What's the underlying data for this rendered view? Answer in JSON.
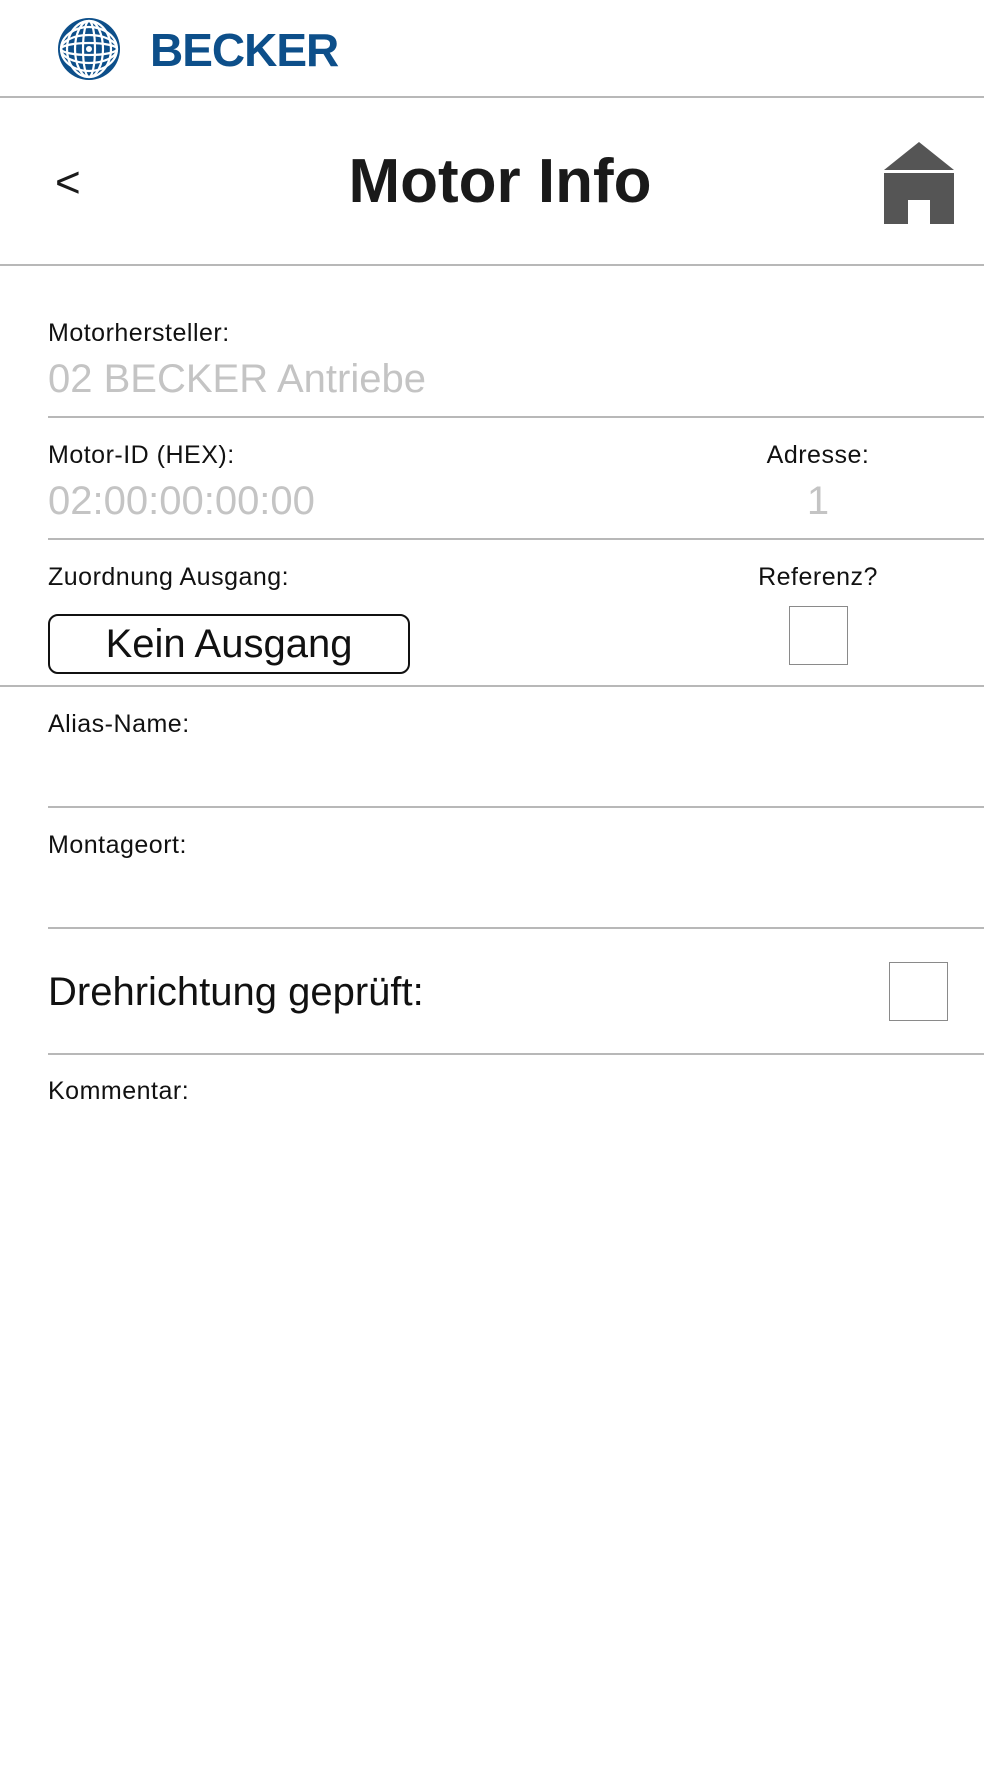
{
  "header": {
    "brand": "BECKER",
    "brand_color": "#0d4f8a",
    "logo_icon": "becker-logo-icon"
  },
  "titlebar": {
    "back_label": "<",
    "title": "Motor Info",
    "home_icon": "home-icon"
  },
  "form": {
    "manufacturer": {
      "label": "Motorhersteller:",
      "value": "02 BECKER Antriebe"
    },
    "motor_id": {
      "label": "Motor-ID (HEX):",
      "value": "02:00:00:00:00"
    },
    "address": {
      "label": "Adresse:",
      "value": "1"
    },
    "output": {
      "label": "Zuordnung Ausgang:",
      "button_label": "Kein Ausgang"
    },
    "reference": {
      "label": "Referenz?",
      "checked": false
    },
    "alias": {
      "label": "Alias-Name:",
      "value": ""
    },
    "location": {
      "label": "Montageort:",
      "value": ""
    },
    "direction_checked": {
      "label": "Drehrichtung geprüft:",
      "checked": false
    },
    "comment": {
      "label": "Kommentar:",
      "value": ""
    }
  },
  "colors": {
    "divider": "#b8b8b8",
    "value_text": "#c4c4c4",
    "home_icon": "#555555"
  }
}
